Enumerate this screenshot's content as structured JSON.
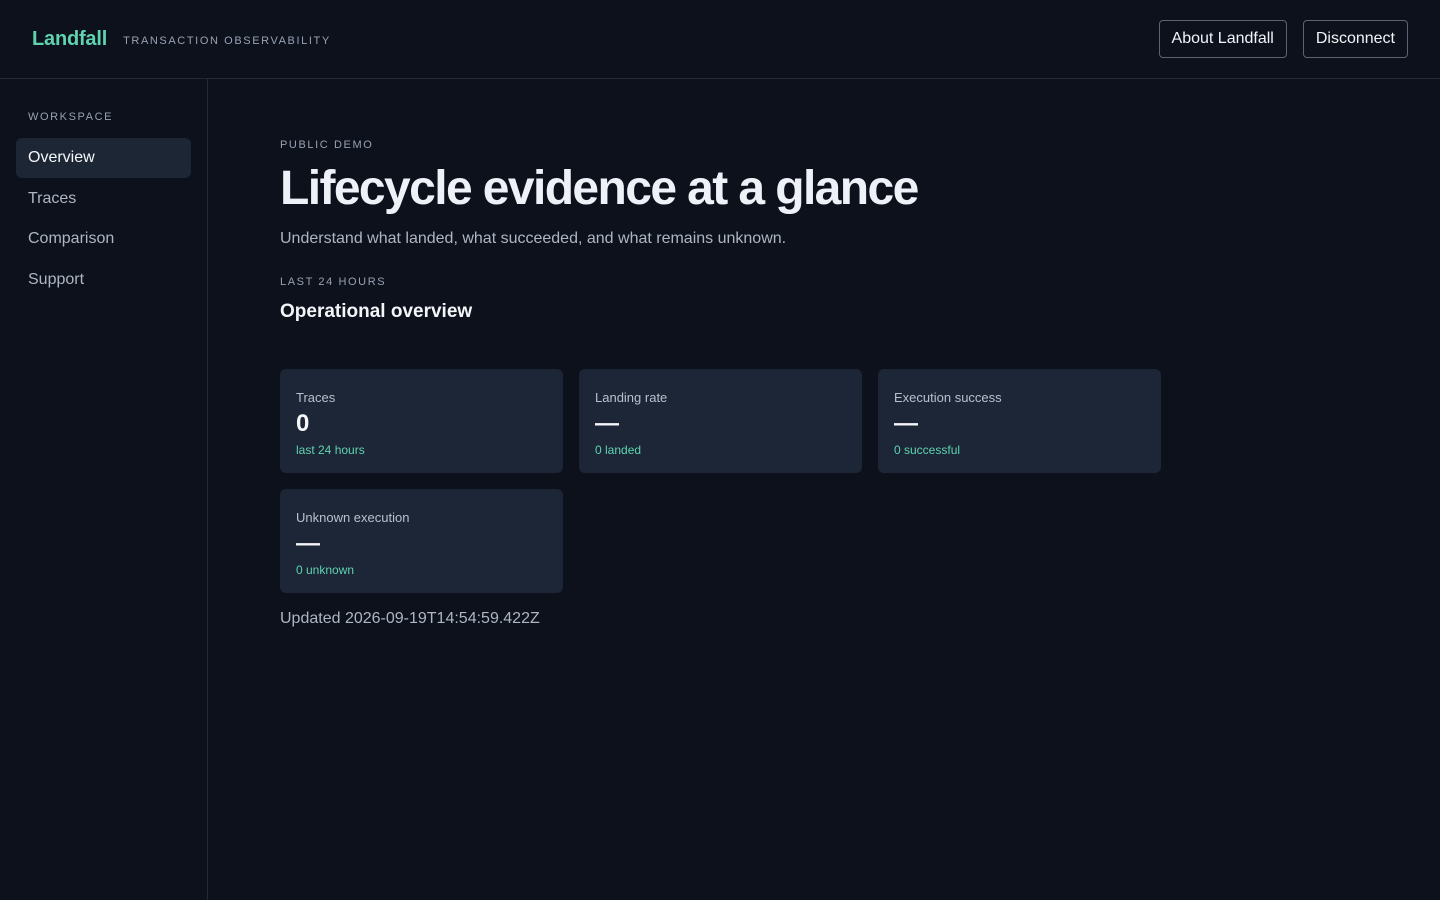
{
  "header": {
    "brand": "Landfall",
    "tagline": "TRANSACTION OBSERVABILITY",
    "about_label": "About Landfall",
    "disconnect_label": "Disconnect"
  },
  "sidebar": {
    "heading": "WORKSPACE",
    "items": [
      {
        "label": "Overview",
        "active": true
      },
      {
        "label": "Traces",
        "active": false
      },
      {
        "label": "Comparison",
        "active": false
      },
      {
        "label": "Support",
        "active": false
      }
    ]
  },
  "main": {
    "eyebrow": "PUBLIC DEMO",
    "title": "Lifecycle evidence at a glance",
    "subtitle": "Understand what landed, what succeeded, and what remains unknown.",
    "section_eyebrow": "LAST 24 HOURS",
    "section_title": "Operational overview",
    "cards": [
      {
        "label": "Traces",
        "value": "0",
        "foot": "last 24 hours"
      },
      {
        "label": "Landing rate",
        "value": "—",
        "foot": "0 landed"
      },
      {
        "label": "Execution success",
        "value": "—",
        "foot": "0 successful"
      },
      {
        "label": "Unknown execution",
        "value": "—",
        "foot": "0 unknown"
      }
    ],
    "updated": "Updated 2026-09-19T14:54:59.422Z"
  },
  "colors": {
    "background": "#0c111b",
    "accent": "#5fd3b0",
    "card": "#1c2636",
    "nav_active": "#1d2635"
  }
}
